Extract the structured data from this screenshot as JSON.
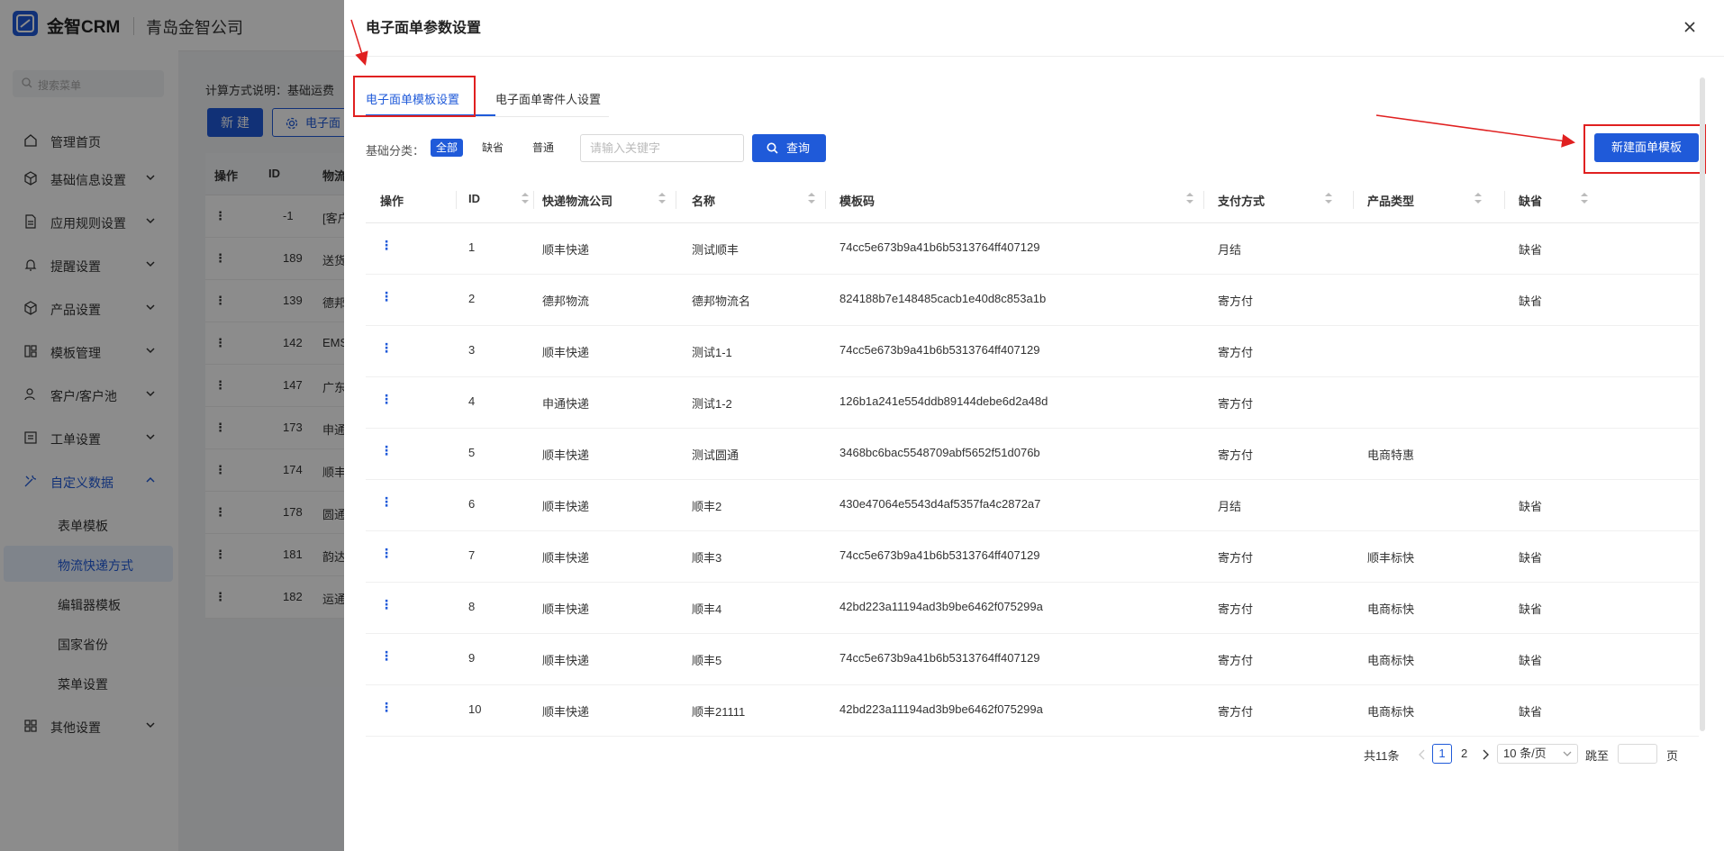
{
  "app": {
    "brand": "金智CRM",
    "company": "青岛金智公司"
  },
  "sidebar": {
    "search_placeholder": "搜索菜单",
    "items": [
      {
        "label": "管理首页",
        "icon": "home-icon"
      },
      {
        "label": "基础信息设置",
        "icon": "cube-icon"
      },
      {
        "label": "应用规则设置",
        "icon": "document-icon"
      },
      {
        "label": "提醒设置",
        "icon": "bell-icon"
      },
      {
        "label": "产品设置",
        "icon": "cube-icon"
      },
      {
        "label": "模板管理",
        "icon": "layout-icon"
      },
      {
        "label": "客户/客户池",
        "icon": "user-icon"
      },
      {
        "label": "工单设置",
        "icon": "list-icon"
      },
      {
        "label": "自定义数据",
        "icon": "tools-icon"
      },
      {
        "label": "其他设置",
        "icon": "grid-icon"
      }
    ],
    "sub_items": [
      "表单模板",
      "物流快递方式",
      "编辑器模板",
      "国家省份",
      "菜单设置"
    ]
  },
  "background_page": {
    "calc_note": "计算方式说明：基础运费",
    "new_button": "新 建",
    "elec_button": "电子面",
    "headers": [
      "操作",
      "ID",
      "物流"
    ],
    "rows": [
      {
        "id": "-1",
        "name": "[客户"
      },
      {
        "id": "189",
        "name": "送货"
      },
      {
        "id": "139",
        "name": "德邦"
      },
      {
        "id": "142",
        "name": "EMS"
      },
      {
        "id": "147",
        "name": "广东"
      },
      {
        "id": "173",
        "name": "申通"
      },
      {
        "id": "174",
        "name": "顺丰"
      },
      {
        "id": "178",
        "name": "圆通"
      },
      {
        "id": "181",
        "name": "韵达"
      },
      {
        "id": "182",
        "name": "运通"
      }
    ]
  },
  "drawer": {
    "title": "电子面单参数设置",
    "tabs": [
      "电子面单模板设置",
      "电子面单寄件人设置"
    ],
    "filter_label": "基础分类：",
    "filter_chips": [
      "全部",
      "缺省",
      "普通"
    ],
    "search_placeholder": "请输入关键字",
    "query_button": "查询",
    "new_template_button": "新建面单模板",
    "table_headers": [
      "操作",
      "ID",
      "快递物流公司",
      "名称",
      "模板码",
      "支付方式",
      "产品类型",
      "缺省"
    ],
    "rows": [
      {
        "op": "⋮",
        "id": "1",
        "company": "顺丰快递",
        "name": "测试顺丰",
        "code": "74cc5e673b9a41b6b5313764ff407129",
        "pay": "月结",
        "ptype": "",
        "default": "缺省"
      },
      {
        "op": "⋮",
        "id": "2",
        "company": "德邦物流",
        "name": "德邦物流名",
        "code": "824188b7e148485cacb1e40d8c853a1b",
        "pay": "寄方付",
        "ptype": "",
        "default": "缺省"
      },
      {
        "op": "⋮",
        "id": "3",
        "company": "顺丰快递",
        "name": "测试1-1",
        "code": "74cc5e673b9a41b6b5313764ff407129",
        "pay": "寄方付",
        "ptype": "",
        "default": ""
      },
      {
        "op": "⋮",
        "id": "4",
        "company": "申通快递",
        "name": "测试1-2",
        "code": "126b1a241e554ddb89144debe6d2a48d",
        "pay": "寄方付",
        "ptype": "",
        "default": ""
      },
      {
        "op": "⋮",
        "id": "5",
        "company": "顺丰快递",
        "name": "测试圆通",
        "code": "3468bc6bac5548709abf5652f51d076b",
        "pay": "寄方付",
        "ptype": "电商特惠",
        "default": ""
      },
      {
        "op": "⋮",
        "id": "6",
        "company": "顺丰快递",
        "name": "顺丰2",
        "code": "430e47064e5543d4af5357fa4c2872a7",
        "pay": "月结",
        "ptype": "",
        "default": "缺省"
      },
      {
        "op": "⋮",
        "id": "7",
        "company": "顺丰快递",
        "name": "顺丰3",
        "code": "74cc5e673b9a41b6b5313764ff407129",
        "pay": "寄方付",
        "ptype": "顺丰标快",
        "default": "缺省"
      },
      {
        "op": "⋮",
        "id": "8",
        "company": "顺丰快递",
        "name": "顺丰4",
        "code": "42bd223a11194ad3b9be6462f075299a",
        "pay": "寄方付",
        "ptype": "电商标快",
        "default": "缺省"
      },
      {
        "op": "⋮",
        "id": "9",
        "company": "顺丰快递",
        "name": "顺丰5",
        "code": "74cc5e673b9a41b6b5313764ff407129",
        "pay": "寄方付",
        "ptype": "电商标快",
        "default": "缺省"
      },
      {
        "op": "⋮",
        "id": "10",
        "company": "顺丰快递",
        "name": "顺丰21111",
        "code": "42bd223a11194ad3b9be6462f075299a",
        "pay": "寄方付",
        "ptype": "电商标快",
        "default": "缺省"
      }
    ],
    "pagination": {
      "total": "共11条",
      "pages": [
        "1",
        "2"
      ],
      "current": "1",
      "page_size": "10 条/页",
      "jump_label": "跳至",
      "page_suffix": "页"
    }
  },
  "colors": {
    "primary": "#1f5ad9",
    "annotation_red": "#e02020"
  }
}
